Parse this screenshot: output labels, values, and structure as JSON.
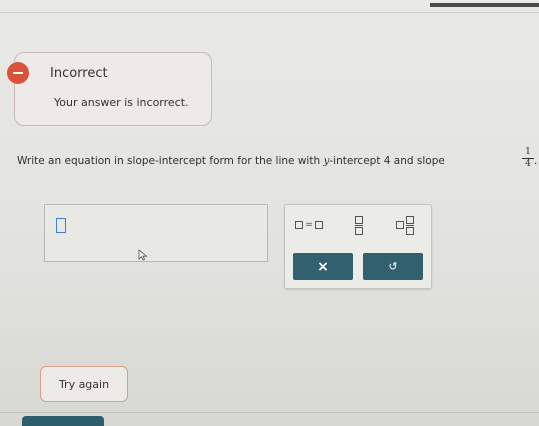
{
  "feedback": {
    "title": "Incorrect",
    "message": "Your answer is incorrect."
  },
  "question": {
    "text_before": "Write an equation in slope-intercept form for the line with ",
    "variable": "y",
    "text_middle": "-intercept ",
    "intercept": "4",
    "text_after": " and slope ",
    "slope_numerator": "1",
    "slope_denominator": "4",
    "ending": "."
  },
  "toolbar": {
    "equals_symbol": "=",
    "clear_symbol": "×",
    "undo_symbol": "↺"
  },
  "actions": {
    "try_again_label": "Try again"
  },
  "colors": {
    "accent": "#33606e",
    "error": "#d9533a",
    "caret": "#3e7fd8"
  }
}
